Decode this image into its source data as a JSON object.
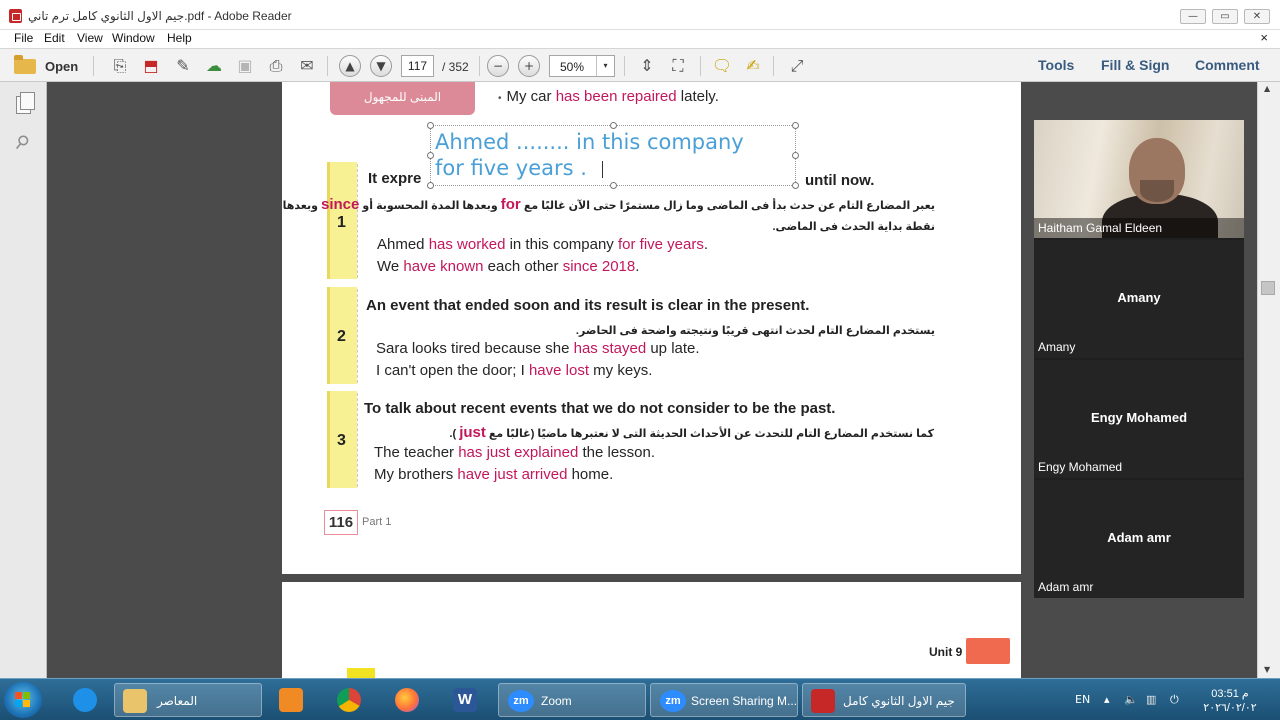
{
  "window": {
    "title": "جيم الاول الثانوي كامل ترم تاني.pdf - Adobe Reader",
    "min_glyph": "—",
    "max_glyph": "▭",
    "close_glyph": "✕"
  },
  "menu": {
    "items": [
      "File",
      "Edit",
      "View",
      "Window",
      "Help"
    ],
    "close_doc": "×"
  },
  "toolbar": {
    "open_label": "Open",
    "current_page": "117",
    "total_pages": "/ 352",
    "zoom": "50%",
    "zoom_dropdown_glyph": "▾",
    "tools_label": "Tools",
    "fill_sign_label": "Fill & Sign",
    "comment_label": "Comment",
    "glyphs": {
      "prev": "▲",
      "next": "▼",
      "zoom_out": "−",
      "zoom_in": "+"
    }
  },
  "document": {
    "passive_tag": "المبنى للمجهول",
    "intro_bullet": "•",
    "intro_prefix": "My car ",
    "intro_hl": "has been repaired",
    "intro_suffix": " lately.",
    "textbox_text": "Ahmed ........ in this company\nfor five years .",
    "section1": {
      "number": "1",
      "heading_start": "It expre",
      "heading_end": "until now.",
      "arabic_a": "يعبر المضارع التام عن حدث بدأ فى الماضى وما زال مستمرًا حتى الآن غالبًا مع",
      "arabic_for": "for",
      "arabic_b": "وبعدها المدة المحسوبة أو",
      "arabic_since": "since",
      "arabic_c": "وبعدها",
      "arabic_2": "نقطة بداية الحدث فى الماضى.",
      "ex1_a": "Ahmed ",
      "ex1_hl": "has worked",
      "ex1_b": " in this company ",
      "ex1_hl2": "for five years",
      "ex1_c": ".",
      "ex2_a": "We ",
      "ex2_hl": "have known",
      "ex2_b": " each other ",
      "ex2_hl2": "since 2018",
      "ex2_c": "."
    },
    "section2": {
      "number": "2",
      "heading": "An event that ended soon and its result is clear in the present.",
      "arabic": "يستخدم المضارع التام لحدث انتهى قريبًا ونتيجته واضحة فى الحاضر.",
      "ex1_a": "Sara looks tired because she ",
      "ex1_hl": "has stayed",
      "ex1_b": " up late.",
      "ex2_a": "I can't open the door; I ",
      "ex2_hl": "have lost",
      "ex2_b": " my keys."
    },
    "section3": {
      "number": "3",
      "heading": "To talk about recent events that we do not consider to be the past.",
      "arabic_a": "كما نستخدم المضارع التام للتحدث عن الأحداث الحديثة التى لا نعتبرها ماضيًا (غالبًا مع",
      "arabic_just": "just",
      "arabic_b": ").",
      "ex1_a": "The teacher ",
      "ex1_hl": "has just explained",
      "ex1_b": " the lesson.",
      "ex2_a": "My brothers ",
      "ex2_hl": "have just arrived",
      "ex2_b": " home."
    },
    "page_number": "116",
    "part_label": "Part 1",
    "next_page_unit": "Unit 9"
  },
  "participants": [
    {
      "name": "Haitham Gamal Eldeen",
      "video": true
    },
    {
      "name": "Amany",
      "video": false
    },
    {
      "name": "Engy Mohamed",
      "video": false
    },
    {
      "name": "Adam amr",
      "video": false
    }
  ],
  "taskbar": {
    "folder_label": "المعاصر",
    "zoom_label": "Zoom",
    "screen_sharing_label": "Screen Sharing M...",
    "reader_label": "جيم الاول الثانوي كامل",
    "lang": "EN",
    "time": "03:51 م",
    "date": "٢٠٢٦/٠٢/٠٢"
  }
}
